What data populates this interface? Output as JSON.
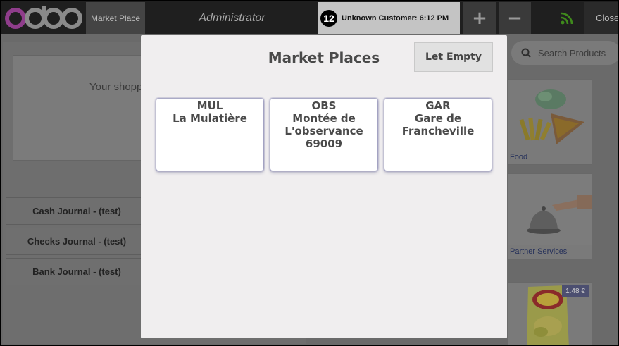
{
  "header": {
    "logo_text": "odoo",
    "market_place_tab": "Market Place",
    "user": "Administrator",
    "order": {
      "number": "12",
      "label": "Unknown Customer: 6:12 PM"
    },
    "add_order_symbol": "+",
    "remove_order_symbol": "−",
    "rss_icon": "rss-icon",
    "close_label": "Close"
  },
  "receipt": {
    "placeholder": "Your shopp"
  },
  "journals": [
    "Cash Journal - (test)",
    "Checks Journal - (test)",
    "Bank Journal - (test)"
  ],
  "search": {
    "placeholder": "Search Products"
  },
  "products": [
    {
      "label": "Food"
    },
    {
      "label": "Partner Services"
    },
    {
      "label": "",
      "price": "1.48 €"
    }
  ],
  "modal": {
    "title": "Market Places",
    "let_empty_label": "Let Empty",
    "market_places": [
      {
        "code": "MUL",
        "name_lines": [
          "La Mulatière"
        ]
      },
      {
        "code": "OBS",
        "name_lines": [
          "Montée de",
          "L'observance",
          "69009"
        ]
      },
      {
        "code": "GAR",
        "name_lines": [
          "Gare de",
          "Francheville"
        ]
      }
    ]
  },
  "colors": {
    "header_bg": "#1f1f1f",
    "modal_bg": "#f0eeef",
    "logo_purple": "#8f3d8b",
    "rss_green": "#3f8a1c"
  }
}
